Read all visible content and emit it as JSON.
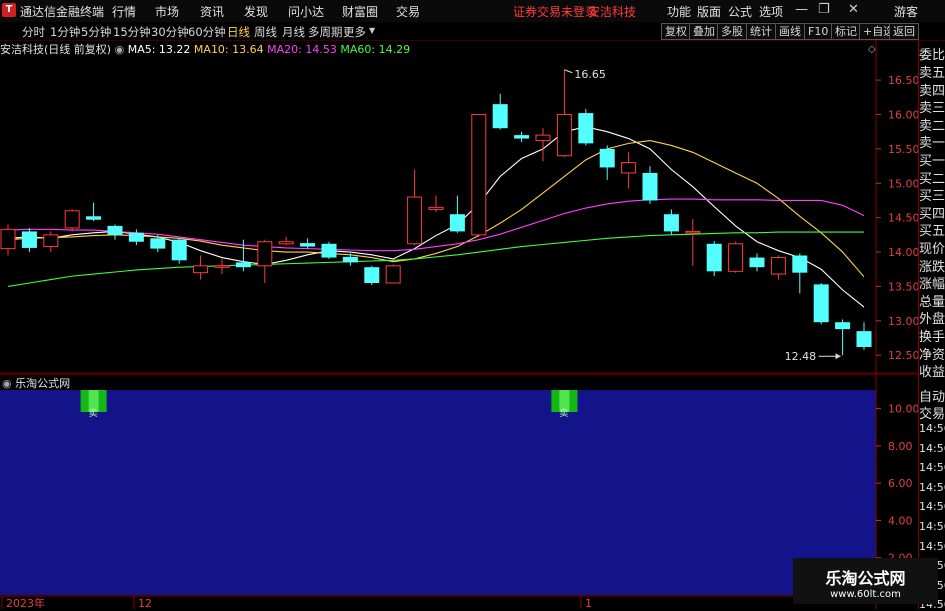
{
  "app": {
    "title": "通达信金融终端",
    "logo": "T"
  },
  "menu": [
    "行情",
    "市场",
    "资讯",
    "发现",
    "问小达",
    "财富圈",
    "交易"
  ],
  "notice": "证券交易未登录",
  "stock_name_top": "安洁科技",
  "right_menu": [
    "功能",
    "版面",
    "公式",
    "选项"
  ],
  "guest": "游客",
  "window_icons": [
    "minimize-icon",
    "restore-icon",
    "close-icon"
  ],
  "toolbar": {
    "periods": [
      "分时",
      "1分钟",
      "5分钟",
      "15分钟",
      "30分钟",
      "60分钟",
      "日线",
      "周线",
      "月线",
      "多周期",
      "更多"
    ],
    "active_period": "日线",
    "buttons": [
      "复权",
      "叠加",
      "多股",
      "统计",
      "画线",
      "F10",
      "标记",
      "+自选",
      "返回"
    ]
  },
  "indicator": {
    "name": "安洁科技(日线 前复权)",
    "ma": [
      {
        "label": "MA5: 13.22",
        "color": "#ffffff"
      },
      {
        "label": "MA10: 13.64",
        "color": "#ffd24a"
      },
      {
        "label": "MA20: 14.53",
        "color": "#ff40ff"
      },
      {
        "label": "MA60: 14.29",
        "color": "#40ff40"
      }
    ]
  },
  "right_panel": {
    "header": "委比",
    "items": [
      "卖五",
      "卖四",
      "卖三",
      "卖二",
      "卖一",
      "买一",
      "买二",
      "买三",
      "买四",
      "买五",
      "现价",
      "涨跌",
      "涨幅",
      "总量",
      "外盘",
      "换手",
      "净资",
      "收益"
    ],
    "lower_items": [
      "自动",
      "交易"
    ],
    "times": [
      "14:56",
      "14:56",
      "14:56",
      "14:56",
      "14:56",
      "14:56",
      "14:56",
      "14:56",
      "14:56",
      "14:56"
    ]
  },
  "x_axis": {
    "labels": [
      "2023年",
      "12",
      "1"
    ]
  },
  "lower": {
    "title": "乐淘公式网",
    "marker_label": "卖",
    "yticks": [
      "10.00",
      "8.00",
      "6.00",
      "4.00",
      "2.00"
    ]
  },
  "watermark": {
    "title": "乐淘公式网",
    "url": "www.60lt.com"
  },
  "chart_data": {
    "type": "candlestick",
    "ylim": [
      12.3,
      16.85
    ],
    "yticks": [
      16.5,
      16.0,
      15.5,
      15.0,
      14.5,
      14.0,
      13.5,
      13.0,
      12.5
    ],
    "high_label": "16.65",
    "low_label": "12.48",
    "candles": [
      {
        "o": 14.05,
        "c": 14.33,
        "h": 14.4,
        "l": 13.95
      },
      {
        "o": 14.3,
        "c": 14.06,
        "h": 14.35,
        "l": 14.0
      },
      {
        "o": 14.08,
        "c": 14.25,
        "h": 14.3,
        "l": 14.0
      },
      {
        "o": 14.35,
        "c": 14.6,
        "h": 14.62,
        "l": 14.3
      },
      {
        "o": 14.52,
        "c": 14.47,
        "h": 14.72,
        "l": 14.45
      },
      {
        "o": 14.38,
        "c": 14.25,
        "h": 14.4,
        "l": 14.18
      },
      {
        "o": 14.28,
        "c": 14.15,
        "h": 14.33,
        "l": 14.1
      },
      {
        "o": 14.2,
        "c": 14.05,
        "h": 14.25,
        "l": 14.0
      },
      {
        "o": 14.18,
        "c": 13.88,
        "h": 14.2,
        "l": 13.83
      },
      {
        "o": 13.7,
        "c": 13.8,
        "h": 13.95,
        "l": 13.6
      },
      {
        "o": 13.78,
        "c": 13.8,
        "h": 13.9,
        "l": 13.68
      },
      {
        "o": 13.85,
        "c": 13.78,
        "h": 14.18,
        "l": 13.72
      },
      {
        "o": 13.8,
        "c": 14.15,
        "h": 14.18,
        "l": 13.55
      },
      {
        "o": 14.12,
        "c": 14.15,
        "h": 14.22,
        "l": 14.1
      },
      {
        "o": 14.13,
        "c": 14.08,
        "h": 14.2,
        "l": 14.05
      },
      {
        "o": 14.12,
        "c": 13.92,
        "h": 14.15,
        "l": 13.9
      },
      {
        "o": 13.93,
        "c": 13.85,
        "h": 13.98,
        "l": 13.8
      },
      {
        "o": 13.78,
        "c": 13.55,
        "h": 13.8,
        "l": 13.52
      },
      {
        "o": 13.55,
        "c": 13.8,
        "h": 13.82,
        "l": 13.55
      },
      {
        "o": 14.12,
        "c": 14.8,
        "h": 15.2,
        "l": 14.1
      },
      {
        "o": 14.62,
        "c": 14.65,
        "h": 14.82,
        "l": 14.58
      },
      {
        "o": 14.55,
        "c": 14.3,
        "h": 14.82,
        "l": 14.28
      },
      {
        "o": 14.25,
        "c": 16.0,
        "h": 16.0,
        "l": 14.22
      },
      {
        "o": 16.15,
        "c": 15.8,
        "h": 16.3,
        "l": 15.78
      },
      {
        "o": 15.7,
        "c": 15.65,
        "h": 15.75,
        "l": 15.6
      },
      {
        "o": 15.62,
        "c": 15.7,
        "h": 15.8,
        "l": 15.32
      },
      {
        "o": 15.4,
        "c": 16.0,
        "h": 16.65,
        "l": 15.38
      },
      {
        "o": 16.02,
        "c": 15.58,
        "h": 16.08,
        "l": 15.55
      },
      {
        "o": 15.5,
        "c": 15.23,
        "h": 15.55,
        "l": 15.05
      },
      {
        "o": 15.15,
        "c": 15.3,
        "h": 15.45,
        "l": 14.92
      },
      {
        "o": 15.15,
        "c": 14.75,
        "h": 15.25,
        "l": 14.7
      },
      {
        "o": 14.55,
        "c": 14.3,
        "h": 14.62,
        "l": 14.25
      },
      {
        "o": 14.28,
        "c": 14.3,
        "h": 14.48,
        "l": 13.8
      },
      {
        "o": 14.12,
        "c": 13.72,
        "h": 14.16,
        "l": 13.65
      },
      {
        "o": 13.72,
        "c": 14.12,
        "h": 14.15,
        "l": 13.7
      },
      {
        "o": 13.92,
        "c": 13.78,
        "h": 13.98,
        "l": 13.72
      },
      {
        "o": 13.68,
        "c": 13.92,
        "h": 13.95,
        "l": 13.6
      },
      {
        "o": 13.95,
        "c": 13.7,
        "h": 13.98,
        "l": 13.4
      },
      {
        "o": 13.53,
        "c": 12.98,
        "h": 13.55,
        "l": 12.95
      },
      {
        "o": 12.98,
        "c": 12.88,
        "h": 13.02,
        "l": 12.5
      },
      {
        "o": 12.85,
        "c": 12.62,
        "h": 12.98,
        "l": 12.58
      }
    ],
    "series": [
      {
        "name": "MA5",
        "color": "#ffffff",
        "values": [
          14.2,
          14.22,
          14.2,
          14.25,
          14.28,
          14.3,
          14.26,
          14.22,
          14.14,
          14.02,
          13.92,
          13.86,
          13.82,
          13.88,
          13.96,
          14.02,
          14.0,
          13.96,
          13.9,
          14.05,
          14.24,
          14.4,
          14.7,
          15.1,
          15.36,
          15.5,
          15.75,
          15.82,
          15.75,
          15.65,
          15.5,
          15.2,
          14.95,
          14.66,
          14.38,
          14.15,
          14.02,
          13.92,
          13.75,
          13.45,
          13.2
        ]
      },
      {
        "name": "MA10",
        "color": "#ffd24a",
        "values": [
          14.18,
          14.2,
          14.21,
          14.22,
          14.24,
          14.25,
          14.24,
          14.22,
          14.2,
          14.16,
          14.1,
          14.06,
          14.02,
          14.0,
          14.0,
          13.98,
          13.96,
          13.92,
          13.86,
          13.9,
          13.98,
          14.08,
          14.24,
          14.42,
          14.62,
          14.86,
          15.1,
          15.34,
          15.5,
          15.58,
          15.62,
          15.55,
          15.45,
          15.3,
          15.15,
          15.0,
          14.78,
          14.52,
          14.28,
          14.0,
          13.64
        ]
      },
      {
        "name": "MA20",
        "color": "#ff40ff",
        "values": [
          14.32,
          14.33,
          14.33,
          14.32,
          14.32,
          14.3,
          14.28,
          14.26,
          14.22,
          14.18,
          14.14,
          14.1,
          14.08,
          14.06,
          14.05,
          14.04,
          14.03,
          14.02,
          14.02,
          14.04,
          14.08,
          14.12,
          14.18,
          14.26,
          14.36,
          14.46,
          14.56,
          14.64,
          14.7,
          14.74,
          14.76,
          14.77,
          14.77,
          14.76,
          14.76,
          14.76,
          14.75,
          14.75,
          14.75,
          14.68,
          14.53
        ]
      },
      {
        "name": "MA60",
        "color": "#40ff40",
        "values": [
          13.5,
          13.55,
          13.6,
          13.65,
          13.68,
          13.71,
          13.74,
          13.76,
          13.78,
          13.79,
          13.8,
          13.81,
          13.82,
          13.83,
          13.84,
          13.85,
          13.86,
          13.87,
          13.88,
          13.9,
          13.93,
          13.96,
          14.0,
          14.04,
          14.08,
          14.11,
          14.14,
          14.17,
          14.2,
          14.22,
          14.24,
          14.25,
          14.26,
          14.27,
          14.28,
          14.28,
          14.29,
          14.29,
          14.29,
          14.29,
          14.29
        ]
      }
    ],
    "lower_range": [
      0,
      11
    ],
    "lower_markers": [
      4,
      26
    ]
  }
}
